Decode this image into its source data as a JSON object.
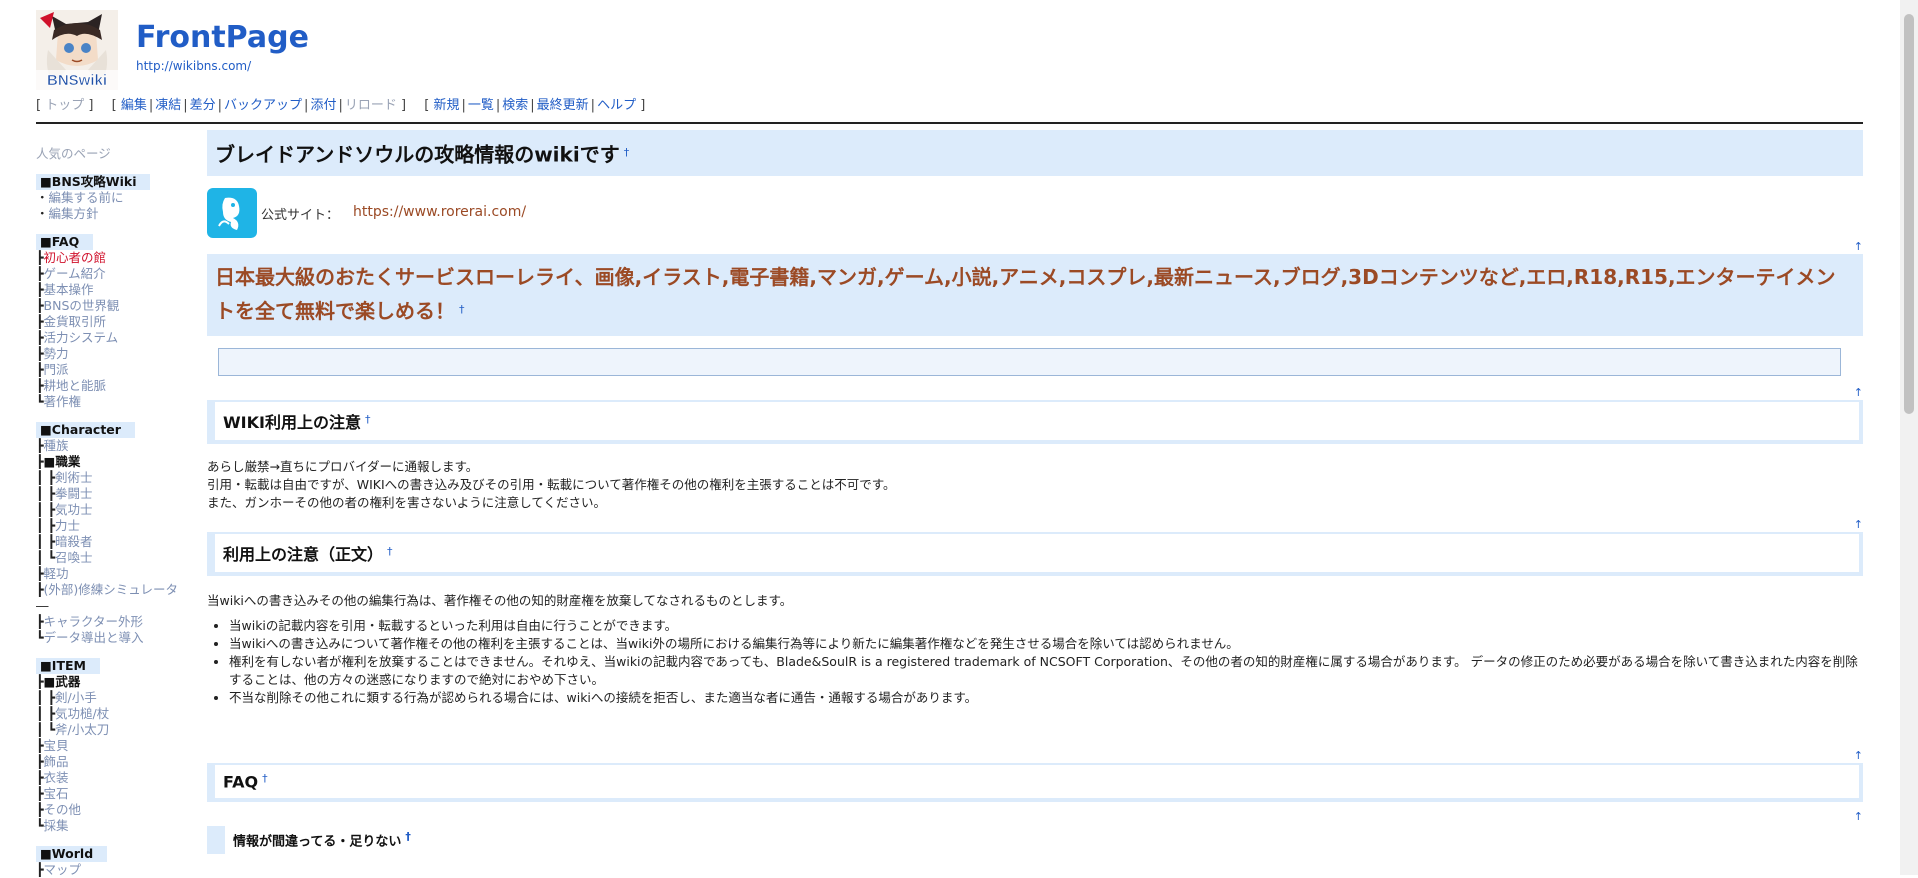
{
  "header": {
    "title": "FrontPage",
    "url": "http://wikibns.com/",
    "logo_text": "BNSwiki"
  },
  "nav": {
    "group1": [
      "トップ"
    ],
    "group2": [
      "編集",
      "凍結",
      "差分",
      "バックアップ",
      "添付",
      "リロード"
    ],
    "group3": [
      "新規",
      "一覧",
      "検索",
      "最終更新",
      "ヘルプ"
    ]
  },
  "sidebar": {
    "popular": "人気のページ",
    "sections": [
      {
        "title": "■BNS攻略Wiki",
        "items": [
          {
            "prefix": "・",
            "label": "編集する前に",
            "style": "link"
          },
          {
            "prefix": "・",
            "label": "編集方針",
            "style": "link"
          }
        ]
      },
      {
        "title": "■FAQ",
        "items": [
          {
            "prefix": "┣",
            "label": "初心者の館",
            "style": "red"
          },
          {
            "prefix": "┣",
            "label": "ゲーム紹介",
            "style": "link"
          },
          {
            "prefix": "┣",
            "label": "基本操作",
            "style": "link"
          },
          {
            "prefix": "┣",
            "label": "BNSの世界観",
            "style": "link"
          },
          {
            "prefix": "┣",
            "label": "金貨取引所",
            "style": "link"
          },
          {
            "prefix": "┣",
            "label": "活力システム",
            "style": "link"
          },
          {
            "prefix": "┣",
            "label": "勢力",
            "style": "link"
          },
          {
            "prefix": "┣",
            "label": "門派",
            "style": "link"
          },
          {
            "prefix": "┣",
            "label": "耕地と能脈",
            "style": "link"
          },
          {
            "prefix": "┗",
            "label": "著作権",
            "style": "link"
          }
        ]
      },
      {
        "title": "■Character",
        "items": [
          {
            "prefix": "┣",
            "label": "種族",
            "style": "link"
          },
          {
            "prefix": "┣",
            "label": "■職業",
            "style": "bold"
          },
          {
            "prefix": "┃ ┣",
            "label": "剣術士",
            "style": "link"
          },
          {
            "prefix": "┃ ┣",
            "label": "拳闘士",
            "style": "link"
          },
          {
            "prefix": "┃ ┣",
            "label": "気功士",
            "style": "link"
          },
          {
            "prefix": "┃ ┣",
            "label": "力士",
            "style": "link"
          },
          {
            "prefix": "┃ ┣",
            "label": "暗殺者",
            "style": "link"
          },
          {
            "prefix": "┃ ┗",
            "label": "召喚士",
            "style": "link"
          },
          {
            "prefix": "┣",
            "label": "軽功",
            "style": "link"
          },
          {
            "prefix": "┣",
            "label": "(外部)修練シミュレータ",
            "style": "link"
          },
          {
            "prefix": "",
            "label": "―",
            "style": "plain"
          },
          {
            "prefix": "┣",
            "label": "キャラクター外形",
            "style": "link"
          },
          {
            "prefix": "┗",
            "label": "データ導出と導入",
            "style": "link"
          }
        ]
      },
      {
        "title": "■ITEM",
        "items": [
          {
            "prefix": "┣",
            "label": "■武器",
            "style": "bold"
          },
          {
            "prefix": "┃ ┣",
            "label": "剣/小手",
            "style": "link"
          },
          {
            "prefix": "┃ ┣",
            "label": "気功槌/杖",
            "style": "link"
          },
          {
            "prefix": "┃ ┗",
            "label": "斧/小太刀",
            "style": "link"
          },
          {
            "prefix": "┣",
            "label": "宝貝",
            "style": "link"
          },
          {
            "prefix": "┣",
            "label": "飾品",
            "style": "link"
          },
          {
            "prefix": "┣",
            "label": "衣装",
            "style": "link"
          },
          {
            "prefix": "┣",
            "label": "宝石",
            "style": "link"
          },
          {
            "prefix": "┣",
            "label": "その他",
            "style": "link"
          },
          {
            "prefix": "┗",
            "label": "採集",
            "style": "link"
          }
        ]
      },
      {
        "title": "■World",
        "items": [
          {
            "prefix": "┣",
            "label": "マップ",
            "style": "link"
          }
        ]
      }
    ]
  },
  "content": {
    "heading_main": "ブレイドアンドソウルの攻略情報のwikiです",
    "anchor": "†",
    "top": "↑",
    "official_label": "公式サイト：",
    "official_url": "https://www.rorerai.com/",
    "promo_heading": "日本最大級のおたくサービスローレライ、画像,イラスト,電子書籍,マンガ,ゲーム,小説,アニメ,コスプレ,最新ニュース,ブログ,3Dコンテンツなど,エロ,R18,R15,エンターテイメントを全て無料で楽しめる！",
    "sec1_title": "WIKI利用上の注意",
    "sec1_lines": [
      "あらし厳禁→直ちにプロバイダーに通報します。",
      "引用・転載は自由ですが、WIKIへの書き込み及びその引用・転載について著作権その他の権利を主張することは不可です。",
      "また、ガンホーその他の者の権利を害さないように注意してください。"
    ],
    "sec2_title": "利用上の注意（正文）",
    "sec2_intro": "当wikiへの書き込みその他の編集行為は、著作権その他の知的財産権を放棄してなされるものとします。",
    "sec2_items": [
      "当wikiの記載内容を引用・転載するといった利用は自由に行うことができます。",
      "当wikiへの書き込みについて著作権その他の権利を主張することは、当wiki外の場所における編集行為等により新たに編集著作権などを発生させる場合を除いては認められません。",
      "権利を有しない者が権利を放棄することはできません。それゆえ、当wikiの記載内容であっても、Blade&SoulR is a registered trademark of NCSOFT Corporation、その他の者の知的財産権に属する場合があります。 データの修正のため必要がある場合を除いて書き込まれた内容を削除することは、他の方々の迷惑になりますので絶対におやめ下さい。",
      "不当な削除その他これに類する行為が認められる場合には、wikiへの接続を拒否し、また適当な者に通告・通報する場合があります。"
    ],
    "sec3_title": "FAQ",
    "sec4_title": "情報が間違ってる・足りない"
  },
  "colors": {
    "link": "#215dc6",
    "heading_bg": "#dcebfb",
    "promo": "#9b4a25",
    "red": "#d0112b"
  }
}
